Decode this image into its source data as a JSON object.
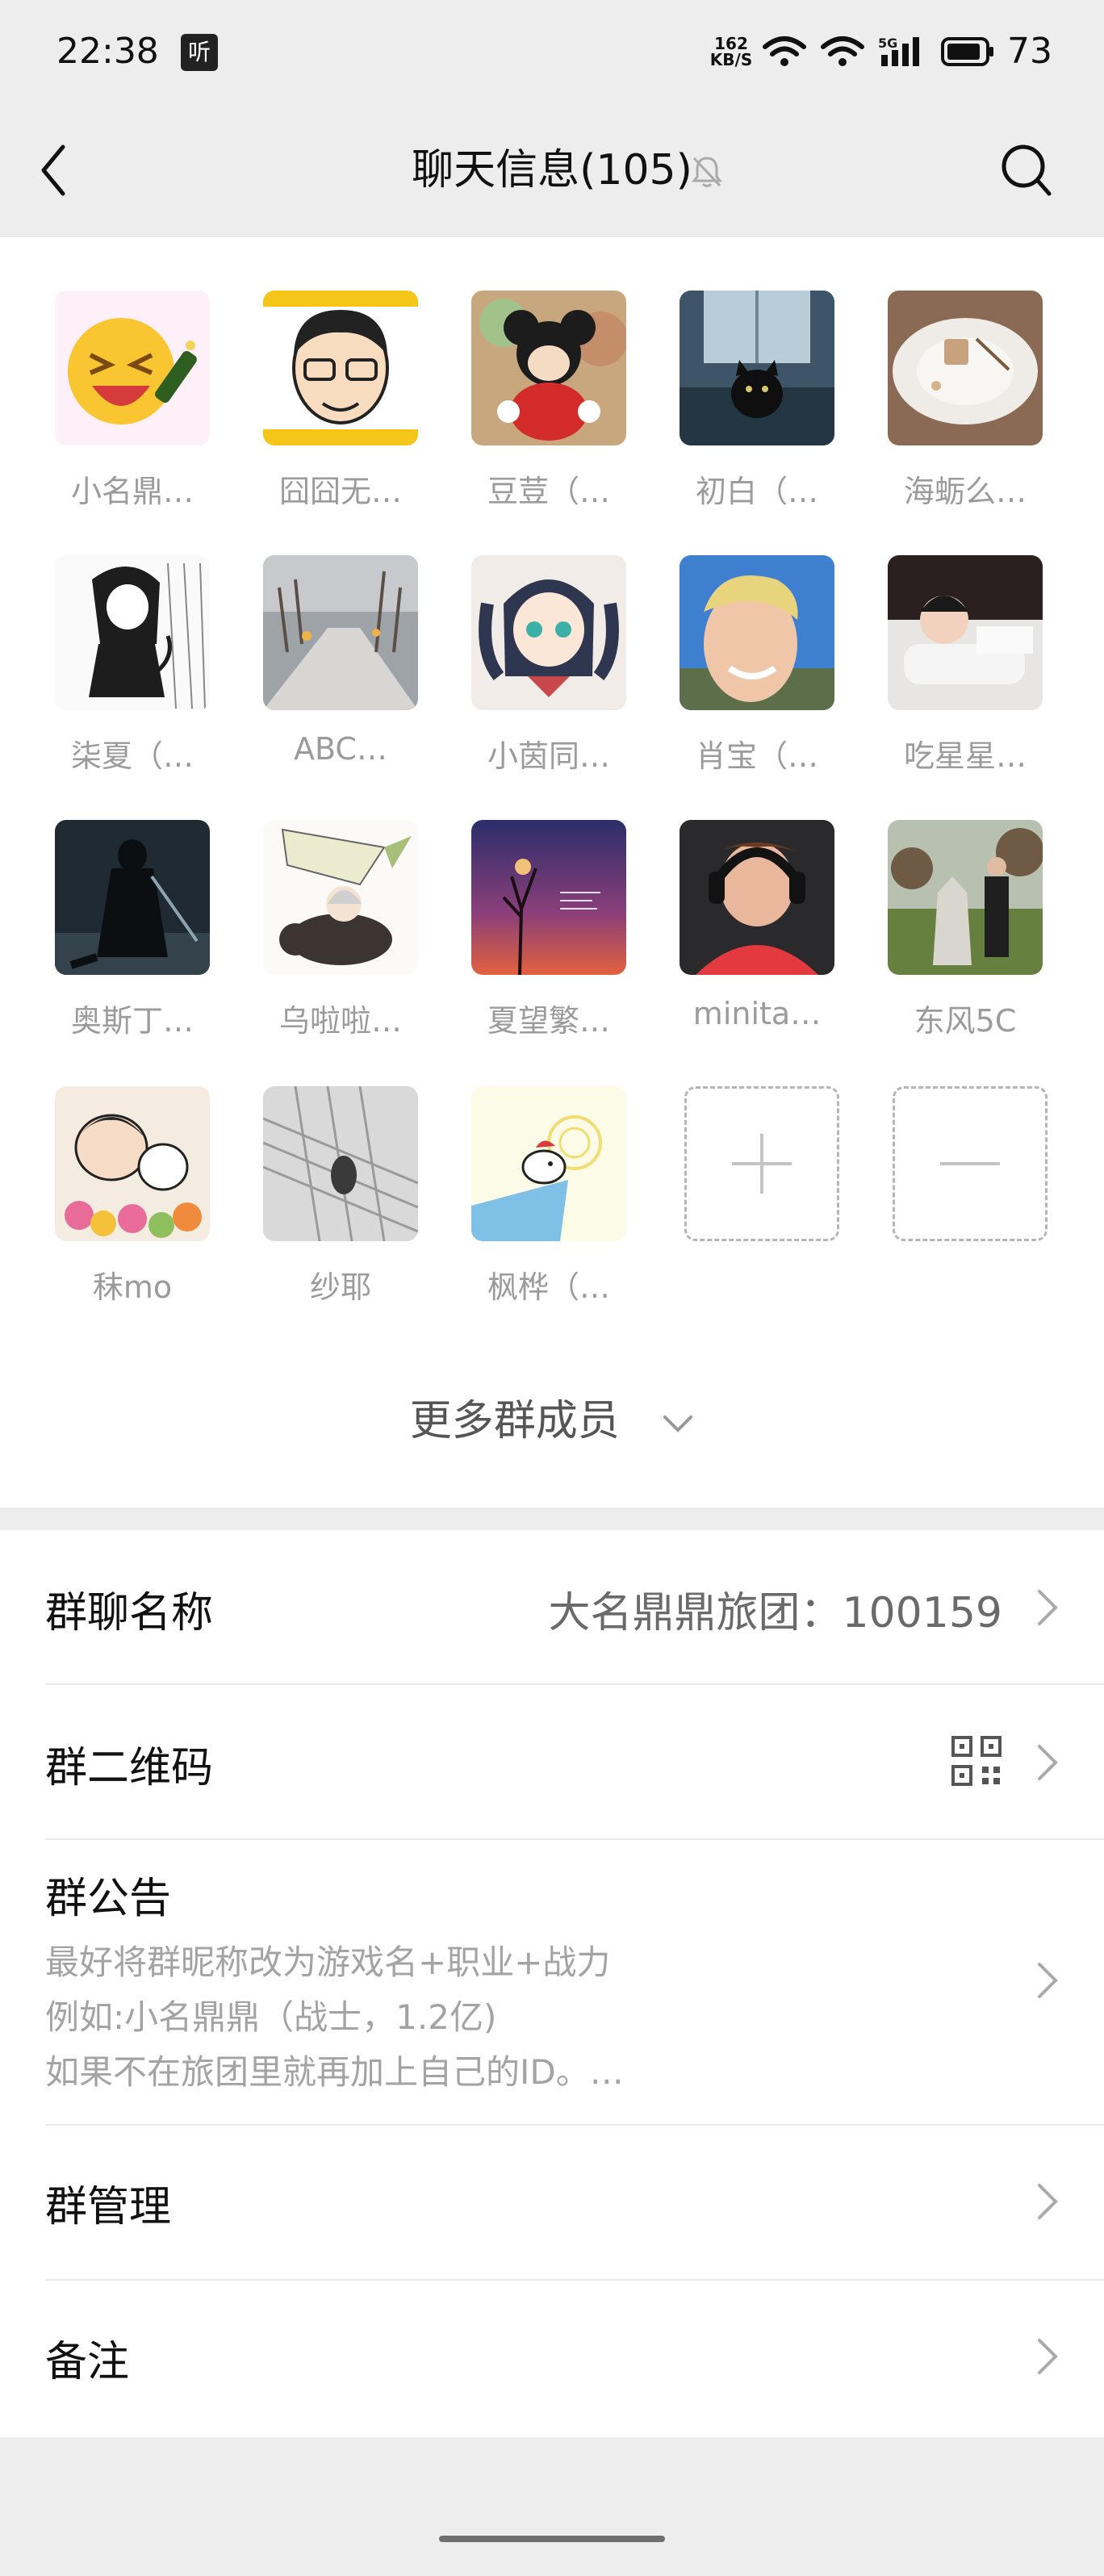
{
  "status_bar": {
    "time": "22:38",
    "app_badge": "听",
    "net_speed_value": "162",
    "net_speed_unit": "KB/S",
    "cellular_label": "5G",
    "battery": "73"
  },
  "nav": {
    "title": "聊天信息(105)",
    "icons": [
      "back-icon",
      "mute-bell-icon",
      "search-icon"
    ]
  },
  "members": [
    {
      "name": "小名鼎…",
      "avatar": "emoji-champagne"
    },
    {
      "name": "囧囧无…",
      "avatar": "cartoon-glasses-man"
    },
    {
      "name": "豆荳（…",
      "avatar": "mickey-toy"
    },
    {
      "name": "初白（…",
      "avatar": "black-cat"
    },
    {
      "name": "海蛎么…",
      "avatar": "dessert-plate"
    },
    {
      "name": "柒夏（…",
      "avatar": "anime-girl-sketch"
    },
    {
      "name": "ABC…",
      "avatar": "snowy-street"
    },
    {
      "name": "小茵同…",
      "avatar": "anime-twin-tails"
    },
    {
      "name": "肖宝（…",
      "avatar": "smiling-man"
    },
    {
      "name": "吃星星…",
      "avatar": "boy-lying"
    },
    {
      "name": "奥斯丁…",
      "avatar": "dark-warrior"
    },
    {
      "name": "乌啦啦…",
      "avatar": "boar-army"
    },
    {
      "name": "夏望繁…",
      "avatar": "sunset-tree"
    },
    {
      "name": "minita…",
      "avatar": "headphones-boy"
    },
    {
      "name": "东风5C",
      "avatar": "statue-park"
    },
    {
      "name": "秣mo",
      "avatar": "cartoon-kids-flowers"
    },
    {
      "name": "纱耶",
      "avatar": "bw-architecture"
    },
    {
      "name": "枫桦（…",
      "avatar": "cartoon-dog"
    }
  ],
  "member_actions": {
    "add": "add-member",
    "remove": "remove-member"
  },
  "more_members_label": "更多群成员",
  "settings": {
    "group_name_label": "群聊名称",
    "group_name_value": "大名鼎鼎旅团：100159",
    "qr_label": "群二维码",
    "announcement_label": "群公告",
    "announcement_lines": [
      "最好将群昵称改为游戏名+职业+战力",
      "例如:小名鼎鼎（战士，1.2亿)",
      "如果不在旅团里就再加上自己的ID。…"
    ],
    "manage_label": "群管理",
    "remark_label": "备注"
  },
  "colors": {
    "background": "#ededed",
    "card": "#ffffff",
    "name_gray": "#9b9b9b"
  }
}
